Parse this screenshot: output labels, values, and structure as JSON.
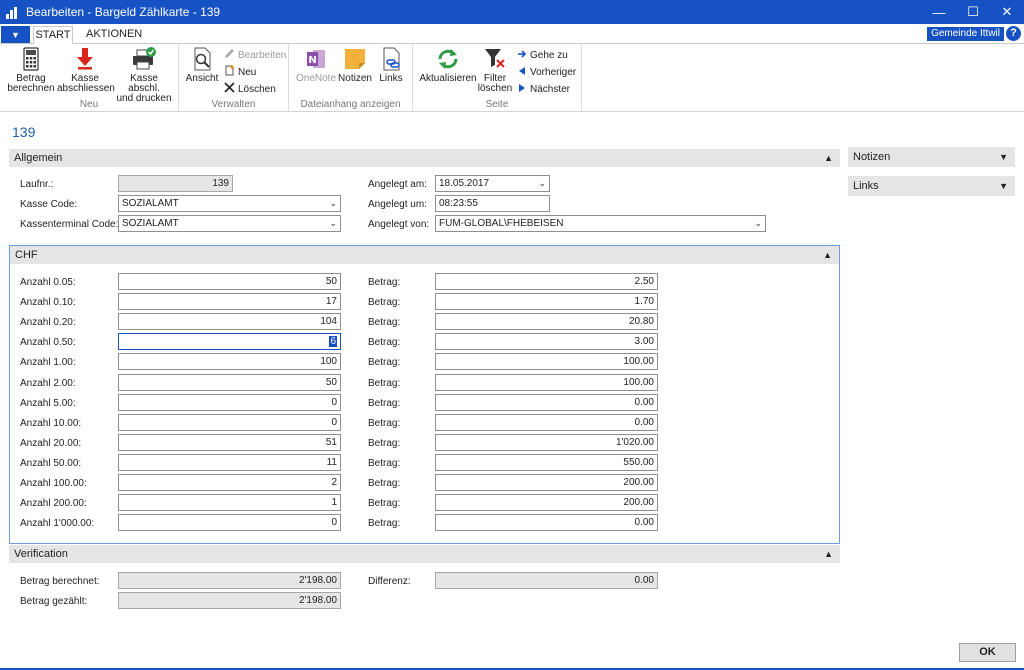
{
  "window": {
    "title": "Bearbeiten - Bargeld Zählkarte - 139",
    "minimize": "—",
    "maximize": "☐",
    "close": "✕"
  },
  "ribbon": {
    "menu_glyph": "▼",
    "tabs": [
      {
        "label": "START",
        "active": true
      },
      {
        "label": "AKTIONEN",
        "active": false
      }
    ],
    "company": "Gemeinde Ittwil",
    "help": "?",
    "groups": {
      "neu": {
        "label": "Neu",
        "buttons": [
          {
            "line1": "Betrag",
            "line2": "berechnen",
            "icon": "calculator-icon"
          },
          {
            "line1": "Kasse",
            "line2": "abschliessen",
            "icon": "down-arrow-icon"
          },
          {
            "line1": "Kasse abschl.",
            "line2": "und drucken",
            "icon": "printer-check-icon"
          }
        ]
      },
      "verwalten": {
        "label": "Verwalten",
        "ansicht": "Ansicht",
        "bearbeiten": "Bearbeiten",
        "neu": "Neu",
        "loeschen": "Löschen"
      },
      "dateianhang": {
        "label": "Dateianhang anzeigen",
        "onenote": "OneNote",
        "notizen": "Notizen",
        "links": "Links"
      },
      "seite": {
        "label": "Seite",
        "aktualisieren": "Aktualisieren",
        "filter_line1": "Filter",
        "filter_line2": "löschen",
        "gehe_zu": "Gehe zu",
        "vorheriger": "Vorheriger",
        "naechster": "Nächster"
      }
    }
  },
  "doc_title": "139",
  "allgemein": {
    "header": "Allgemein",
    "laufnr_label": "Laufnr.:",
    "laufnr": "139",
    "kasse_code_label": "Kasse Code:",
    "kasse_code": "SOZIALAMT",
    "kassenterminal_label": "Kassenterminal Code:",
    "kassenterminal": "SOZIALAMT",
    "angelegt_am_label": "Angelegt am:",
    "angelegt_am": "18.05.2017",
    "angelegt_um_label": "Angelegt um:",
    "angelegt_um": "08:23:55",
    "angelegt_von_label": "Angelegt von:",
    "angelegt_von": "FUM-GLOBAL\\FHEBEISEN"
  },
  "chf": {
    "header": "CHF",
    "betrag_label": "Betrag:",
    "rows": [
      {
        "label": "Anzahl 0.05:",
        "count": "50",
        "betrag": "2.50"
      },
      {
        "label": "Anzahl 0.10:",
        "count": "17",
        "betrag": "1.70"
      },
      {
        "label": "Anzahl 0.20:",
        "count": "104",
        "betrag": "20.80"
      },
      {
        "label": "Anzahl 0.50:",
        "count": "6",
        "betrag": "3.00"
      },
      {
        "label": "Anzahl 1.00:",
        "count": "100",
        "betrag": "100.00"
      },
      {
        "label": "Anzahl 2.00:",
        "count": "50",
        "betrag": "100.00"
      },
      {
        "label": "Anzahl 5.00:",
        "count": "0",
        "betrag": "0.00"
      },
      {
        "label": "Anzahl 10.00:",
        "count": "0",
        "betrag": "0.00"
      },
      {
        "label": "Anzahl 20.00:",
        "count": "51",
        "betrag": "1'020.00"
      },
      {
        "label": "Anzahl 50.00:",
        "count": "11",
        "betrag": "550.00"
      },
      {
        "label": "Anzahl 100.00:",
        "count": "2",
        "betrag": "200.00"
      },
      {
        "label": "Anzahl 200.00:",
        "count": "1",
        "betrag": "200.00"
      },
      {
        "label": "Anzahl 1'000.00:",
        "count": "0",
        "betrag": "0.00"
      }
    ]
  },
  "verification": {
    "header": "Verification",
    "berechnet_label": "Betrag berechnet:",
    "berechnet": "2'198.00",
    "gezaehlt_label": "Betrag gezählt:",
    "gezaehlt": "2'198.00",
    "differenz_label": "Differenz:",
    "differenz": "0.00"
  },
  "factboxes": {
    "notizen": "Notizen",
    "links": "Links"
  },
  "ok_label": "OK",
  "colors": {
    "accent": "#1752c4",
    "doc_title": "#1f5fae"
  }
}
